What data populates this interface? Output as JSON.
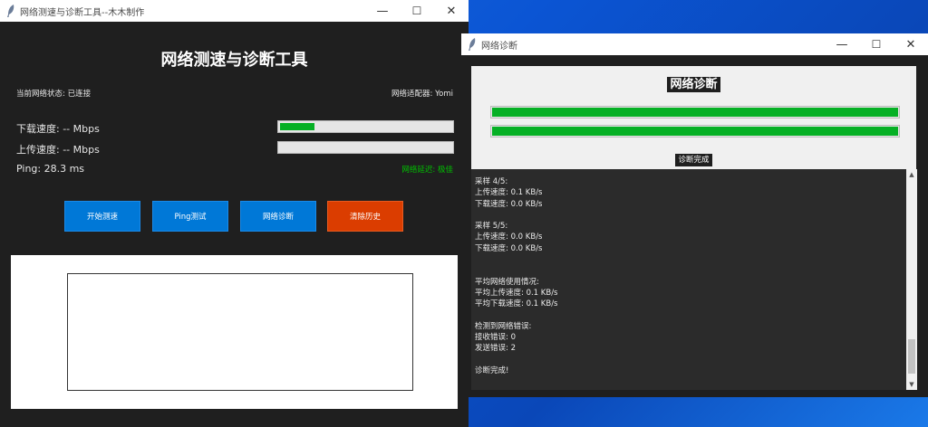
{
  "main_window": {
    "title": "网络测速与诊断工具--木木制作",
    "controls": {
      "minimize": "—",
      "maximize": "☐",
      "close": "✕"
    },
    "heading": "网络测速与诊断工具",
    "status_text": "当前网络状态: 已连接",
    "adapter_text": "网络适配器: Yomi",
    "download_label": "下载速度: -- Mbps",
    "upload_label": "上传速度: -- Mbps",
    "ping_label": "Ping: 28.3 ms",
    "latency_text": "网络延迟: 极佳",
    "download_progress": 0.2,
    "upload_progress": 0.0,
    "buttons": {
      "start": "开始测速",
      "ping": "Ping测试",
      "diagnose": "网络诊断",
      "clear": "清除历史"
    },
    "colors": {
      "accent": "#0078d7",
      "danger": "#db3d00",
      "progress": "#06b025",
      "latency_good": "#00c000"
    }
  },
  "diag_window": {
    "title": "网络诊断",
    "controls": {
      "minimize": "—",
      "maximize": "☐",
      "close": "✕"
    },
    "heading": "网络诊断",
    "progress_1": 1.0,
    "progress_2": 1.0,
    "status": "诊断完成",
    "log_lines": [
      "采样 4/5:",
      "上传速度: 0.1 KB/s",
      "下载速度: 0.0 KB/s",
      "",
      "采样 5/5:",
      "上传速度: 0.0 KB/s",
      "下载速度: 0.0 KB/s",
      "",
      "",
      "平均网络使用情况:",
      "平均上传速度: 0.1 KB/s",
      "平均下载速度: 0.1 KB/s",
      "",
      "检测到网络错误:",
      "接收错误: 0",
      "发送错误: 2",
      "",
      "诊断完成!"
    ],
    "scroll_up": "▲",
    "scroll_down": "▼"
  }
}
